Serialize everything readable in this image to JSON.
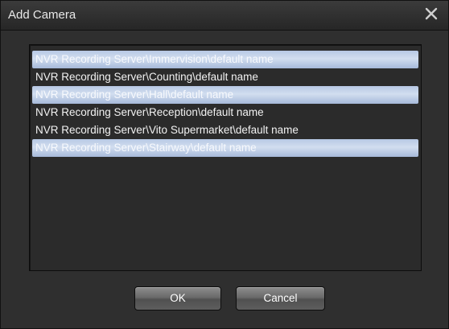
{
  "dialog": {
    "title": "Add Camera",
    "close_icon": "close-x-icon"
  },
  "camera_list": {
    "items": [
      {
        "label": "NVR Recording Server\\Immervision\\default name",
        "selected": true
      },
      {
        "label": "NVR Recording Server\\Counting\\default name",
        "selected": false
      },
      {
        "label": "NVR Recording Server\\Hall\\default name",
        "selected": true
      },
      {
        "label": "NVR Recording Server\\Reception\\default name",
        "selected": false
      },
      {
        "label": "NVR Recording Server\\Vito Supermarket\\default name",
        "selected": false
      },
      {
        "label": "NVR Recording Server\\Stairway\\default name",
        "selected": true
      }
    ]
  },
  "buttons": {
    "ok_label": "OK",
    "cancel_label": "Cancel"
  },
  "colors": {
    "background": "#2f2f2f",
    "selection": "#c4d3ea",
    "text": "#f2f2f2"
  }
}
